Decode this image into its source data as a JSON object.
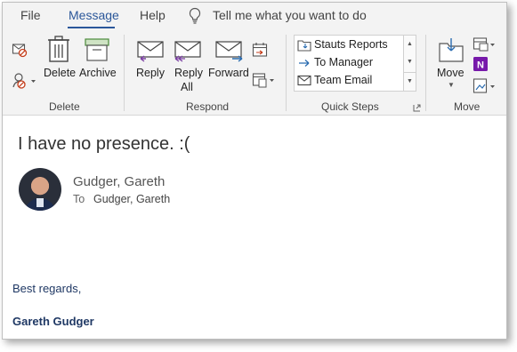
{
  "menu": {
    "tabs": [
      {
        "label": "File"
      },
      {
        "label": "Message"
      },
      {
        "label": "Help"
      }
    ],
    "active_tab": "Message",
    "tell_me": "Tell me what you want to do"
  },
  "ribbon": {
    "delete_group": {
      "label": "Delete",
      "delete_button": "Delete",
      "archive_button": "Archive"
    },
    "respond_group": {
      "label": "Respond",
      "reply_button": "Reply",
      "reply_all_line1": "Reply",
      "reply_all_line2": "All",
      "forward_button": "Forward"
    },
    "quick_steps_group": {
      "label": "Quick Steps",
      "items": [
        {
          "label": "Stauts Reports"
        },
        {
          "label": "To Manager"
        },
        {
          "label": "Team Email"
        }
      ]
    },
    "move_group": {
      "label": "Move",
      "move_button": "Move"
    }
  },
  "message": {
    "subject": "I have no presence. :(",
    "sender": "Gudger, Gareth",
    "to_label": "To",
    "to_value": "Gudger, Gareth",
    "body_regards": "Best regards,",
    "body_signature": "Gareth Gudger"
  },
  "colors": {
    "accent": "#2b579a",
    "ribbon_bg": "#f3f3f3",
    "signature_text": "#1f3864"
  }
}
